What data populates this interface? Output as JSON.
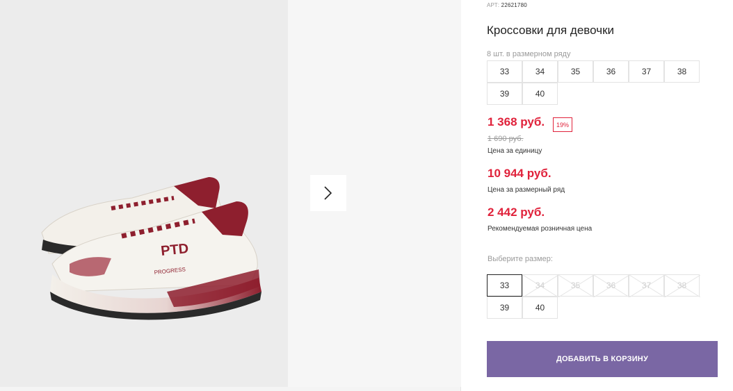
{
  "product": {
    "sku_label": "АРТ:",
    "sku_value": "22621780",
    "title": "Кроссовки для девочки",
    "set_note": "8 шт. в размерном ряду",
    "image_logo": "PTD",
    "image_tagline": "PROGRESS"
  },
  "size_run": [
    "33",
    "34",
    "35",
    "36",
    "37",
    "38",
    "39",
    "40"
  ],
  "pricing": {
    "current": "1 368 руб.",
    "discount": "19%",
    "old": "1 690 руб.",
    "unit_label": "Цена за единицу",
    "run_price": "10 944 руб.",
    "run_label": "Цена за размерный ряд",
    "retail_price": "2 442 руб.",
    "retail_label": "Рекомендуемая розничная цена"
  },
  "size_picker": {
    "label": "Выберите размер:",
    "selected": "33",
    "sizes": [
      {
        "value": "33",
        "state": "selected"
      },
      {
        "value": "34",
        "state": "disabled"
      },
      {
        "value": "35",
        "state": "disabled"
      },
      {
        "value": "36",
        "state": "disabled"
      },
      {
        "value": "37",
        "state": "disabled"
      },
      {
        "value": "38",
        "state": "disabled"
      },
      {
        "value": "39",
        "state": "available"
      },
      {
        "value": "40",
        "state": "available"
      }
    ]
  },
  "cart": {
    "button_label": "ДОБАВИТЬ В КОРЗИНУ"
  },
  "gallery": {
    "next_icon": "chevron-right-icon"
  },
  "colors": {
    "price_red": "#e0223b",
    "button_purple": "#7a67a4",
    "shoe_burgundy": "#8e1f2e",
    "shoe_white": "#f3f0ea"
  }
}
